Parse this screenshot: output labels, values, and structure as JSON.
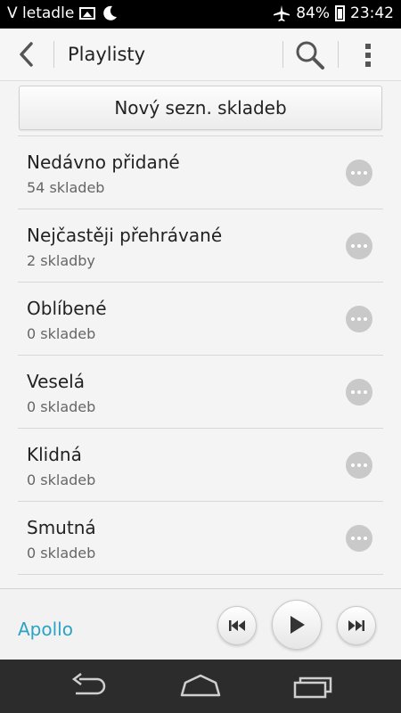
{
  "status_bar": {
    "carrier_text": "V letadle",
    "battery_percent": "84%",
    "time": "23:42",
    "icons": [
      "image-icon",
      "moon-icon",
      "airplane-icon",
      "battery-icon"
    ]
  },
  "action_bar": {
    "title": "Playlisty",
    "icons": [
      "back-arrow-icon",
      "search-icon",
      "overflow-menu-icon"
    ]
  },
  "new_playlist_label": "Nový sezn. skladeb",
  "playlists": [
    {
      "name": "Nedávno přidané",
      "count": "54 skladeb"
    },
    {
      "name": "Nejčastěji přehrávané",
      "count": "2 skladby"
    },
    {
      "name": "Oblíbené",
      "count": "0 skladeb"
    },
    {
      "name": "Veselá",
      "count": "0 skladeb"
    },
    {
      "name": "Klidná",
      "count": "0 skladeb"
    },
    {
      "name": "Smutná",
      "count": "0 skladeb"
    }
  ],
  "player": {
    "app_name": "Apollo",
    "icons": [
      "previous-track-icon",
      "play-icon",
      "next-track-icon"
    ]
  },
  "nav_bar": {
    "icons": [
      "nav-back-icon",
      "nav-home-icon",
      "nav-recents-icon"
    ]
  },
  "colors": {
    "accent": "#2aa3c6",
    "status_bar": "#000000",
    "nav_bar": "#2c2c2c",
    "more_button": "#c9c9c9"
  }
}
